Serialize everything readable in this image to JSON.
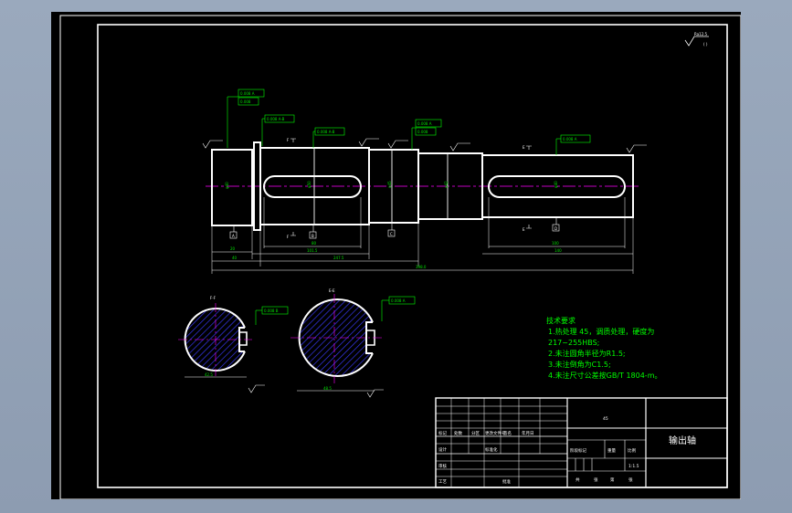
{
  "drawing": {
    "roughness_symbol": "Ra12.5",
    "tolerances": {
      "t1a": "0.008 A",
      "t1b": "0.008",
      "t2": "0.008 A-B",
      "t3": "0.008 A-B",
      "t4a": "0.008 A",
      "t4b": "0.008",
      "t5": "0.008 A",
      "t6": "0.008 B",
      "t7": "0.008 A"
    },
    "datums": {
      "a": "A",
      "b": "B",
      "c": "C",
      "d": "D"
    },
    "dimensions": {
      "d1": "20",
      "d2": "40",
      "d3": "80",
      "d4": "101.5",
      "d5": "247.5",
      "d6": "398.0",
      "d7": "100",
      "d8": "140",
      "d9": "42.5",
      "d10": "48.5"
    },
    "section_labels": {
      "s1": "F-F",
      "s2": "E-E"
    },
    "cut_labels": {
      "c1": "F",
      "c2": "F",
      "c3": "E",
      "c4": "E"
    }
  },
  "tech_notes": {
    "heading": "技术要求",
    "lines": [
      "1.热处理 45，调质处理，硬度为",
      "217~255HBS;",
      "2.未注圆角半径为R1.5;",
      "3.未注倒角为C1.5;",
      "4.未注尺寸公差按GB/T 1804-m。"
    ]
  },
  "title_block": {
    "part_name": "输出轴",
    "material": "45",
    "scale": "1:1.5",
    "labels": {
      "mark": "标记",
      "count": "处数",
      "zone": "分区",
      "doc_no": "更改文件号",
      "sign": "签名",
      "date": "年月日",
      "design": "设计",
      "std": "标准化",
      "stage_mark": "阶段标记",
      "weight": "重量",
      "ratio": "比例",
      "review": "审核",
      "craft": "工艺",
      "approve": "批准",
      "sheet_a": "共",
      "sheet_b": "张",
      "sheet_c": "第",
      "sheet_d": "张"
    }
  }
}
